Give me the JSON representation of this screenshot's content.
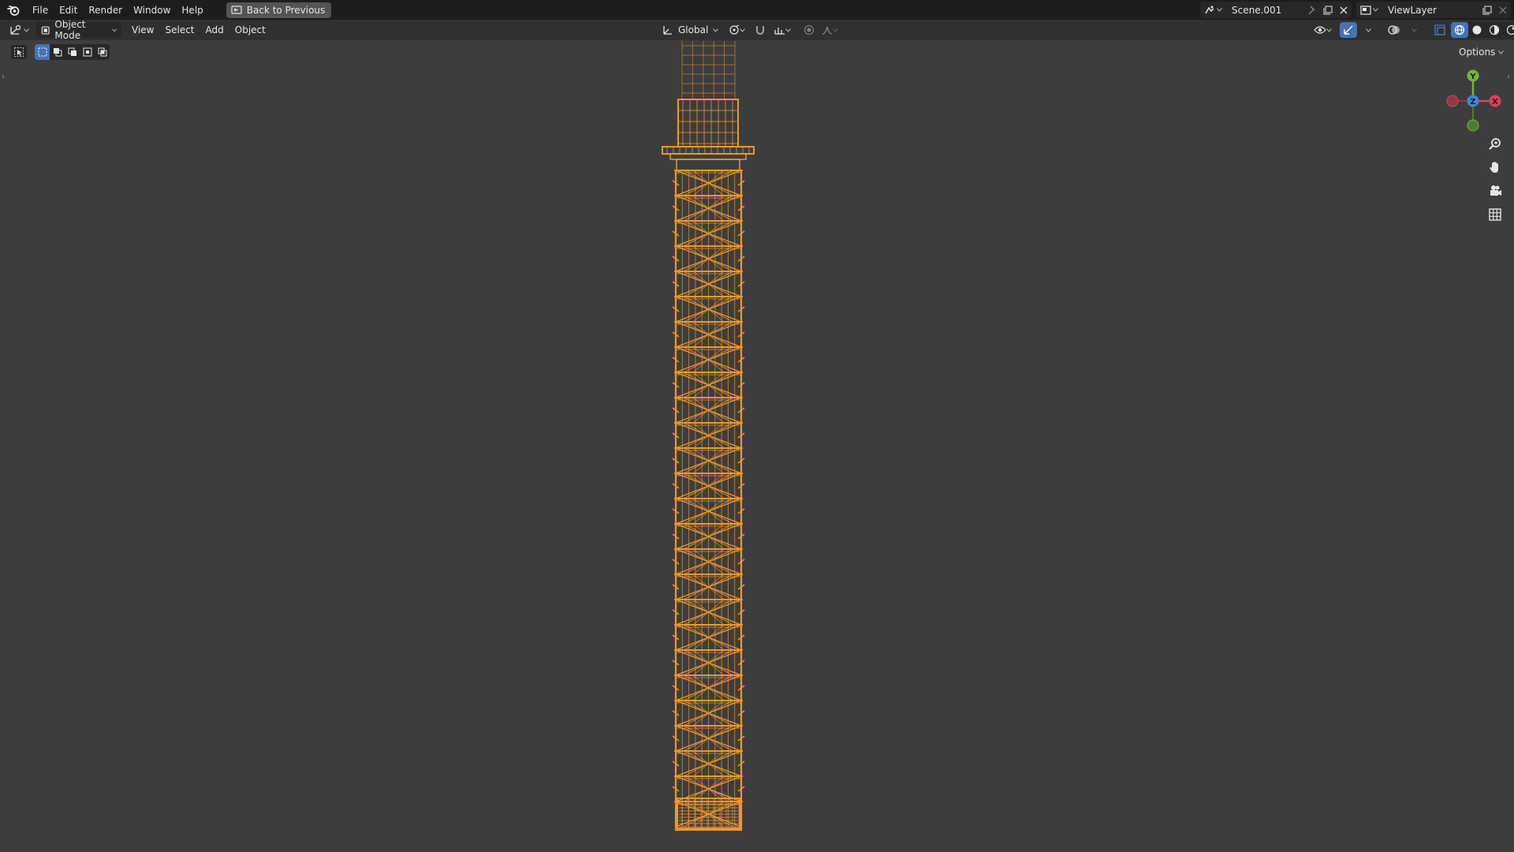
{
  "topbar": {
    "menus": [
      "File",
      "Edit",
      "Render",
      "Window",
      "Help"
    ],
    "back_button": "Back to Previous",
    "scene_name": "Scene.001",
    "view_layer": "ViewLayer"
  },
  "header": {
    "mode": "Object Mode",
    "menus": [
      "View",
      "Select",
      "Add",
      "Object"
    ],
    "transform_orientation": "Global"
  },
  "toolbar": {
    "options_label": "Options"
  },
  "gizmo": {
    "axes": {
      "x": "X",
      "y": "Y",
      "z": "Z"
    },
    "x_color": "#e04057",
    "y_color": "#74b53a",
    "z_color": "#3f86e0"
  },
  "theme": {
    "viewport_bg": "#3d3d3d",
    "selection_color": "#f0962c",
    "active_button": "#4772b3"
  },
  "viewport": {
    "shading": "wireframe",
    "selected_object_outline": "orange"
  }
}
